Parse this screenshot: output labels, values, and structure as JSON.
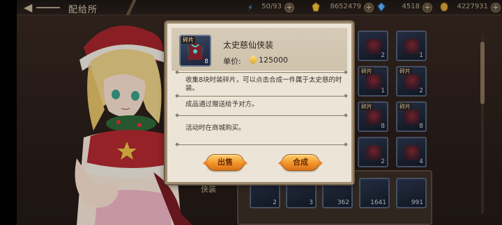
{
  "header": {
    "title": "配给所"
  },
  "resources": [
    {
      "name": "stamina",
      "icon": "lightning-icon",
      "value": "50/93",
      "color": "#4aa3ff"
    },
    {
      "name": "gold",
      "icon": "gold-ingot-icon",
      "value": "8652479",
      "color": "#f3c53a"
    },
    {
      "name": "gem",
      "icon": "gem-icon",
      "value": "4518",
      "color": "#5fb4ff"
    },
    {
      "name": "coin",
      "icon": "coin-icon",
      "value": "4227931",
      "color": "#e0a43c"
    }
  ],
  "background_grid": {
    "label": "侠装",
    "slots": [
      {
        "tag": "",
        "count": "2"
      },
      {
        "tag": "",
        "count": "1"
      },
      {
        "tag": "碎片",
        "count": "1"
      },
      {
        "tag": "碎片",
        "count": "2"
      },
      {
        "tag": "碎片",
        "count": "8"
      },
      {
        "tag": "碎片",
        "count": "8"
      },
      {
        "tag": "",
        "count": "2"
      },
      {
        "tag": "",
        "count": "4"
      }
    ],
    "bottom_counts": [
      "2",
      "3",
      "362",
      "1641",
      "991"
    ]
  },
  "modal": {
    "item": {
      "tag": "碎片",
      "count": "8",
      "name": "太史慈仙侠装",
      "price_label": "单价:",
      "price": "125000"
    },
    "descriptions": [
      "收集8块时装碎片，可以点击合成一件属于太史慈的时装。",
      "成品通过赠送给予对方。",
      "活动时在商城购买。"
    ],
    "buttons": {
      "sell": "出售",
      "combine": "合成"
    }
  }
}
